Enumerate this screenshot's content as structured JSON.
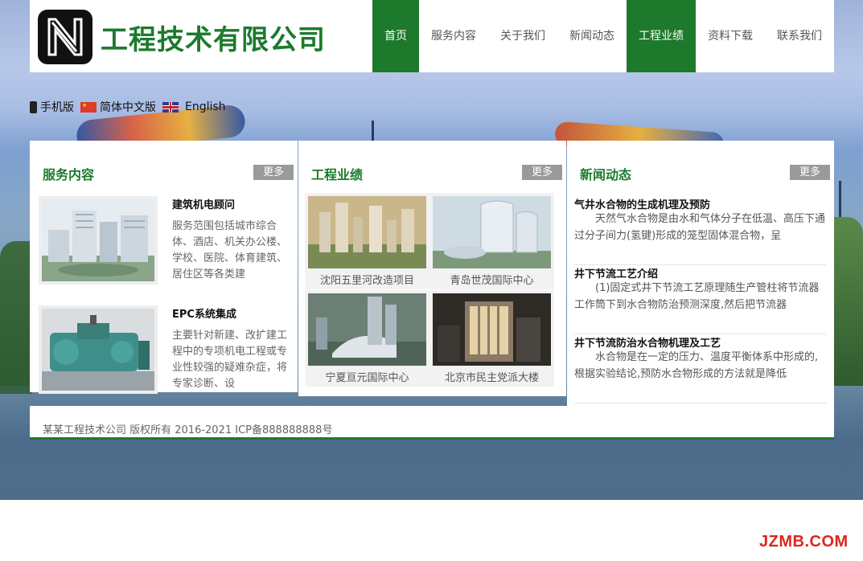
{
  "header": {
    "site_title": "工程技术有限公司",
    "logo_icon": "nfc-n-logo-icon"
  },
  "nav": {
    "items": [
      {
        "label": "首页",
        "active": true
      },
      {
        "label": "服务内容",
        "active": false
      },
      {
        "label": "关于我们",
        "active": false
      },
      {
        "label": "新闻动态",
        "active": false
      },
      {
        "label": "工程业绩",
        "active": true
      },
      {
        "label": "资料下载",
        "active": false
      },
      {
        "label": "联系我们",
        "active": false
      }
    ]
  },
  "langbar": {
    "mobile": "手机版",
    "zh": "简体中文版",
    "en": "English"
  },
  "services": {
    "title": "服务内容",
    "more": "更多",
    "items": [
      {
        "title": "建筑机电顾问",
        "desc": "服务范围包括城市综合体、酒店、机关办公楼、学校、医院、体育建筑、居住区等各类建"
      },
      {
        "title": "EPC系统集成",
        "desc": "主要针对新建、改扩建工程中的专项机电工程或专业性较强的疑难杂症，将专家诊断、设"
      }
    ]
  },
  "projects": {
    "title": "工程业绩",
    "more": "更多",
    "items": [
      {
        "caption": "沈阳五里河改造项目"
      },
      {
        "caption": "青岛世茂国际中心"
      },
      {
        "caption": "宁夏亘元国际中心"
      },
      {
        "caption": "北京市民主党派大楼"
      }
    ]
  },
  "news": {
    "title": "新闻动态",
    "more": "更多",
    "items": [
      {
        "title": "气井水合物的生成机理及预防",
        "body": "天然气水合物是由水和气体分子在低温、高压下通过分子间力(氢键)形成的笼型固体混合物，呈"
      },
      {
        "title": "井下节流工艺介绍",
        "body": "(1)固定式井下节流工艺原理随生产管柱将节流器工作筒下到水合物防治预测深度,然后把节流器"
      },
      {
        "title": "井下节流防治水合物机理及工艺",
        "body": "水合物是在一定的压力、温度平衡体系中形成的,根据实验结论,预防水合物形成的方法就是降低"
      }
    ]
  },
  "footer": {
    "text": "某某工程技术公司  版权所有 2016-2021 ICP备888888888号"
  },
  "watermark": "JZMB.COM",
  "colors": {
    "brand_green": "#1d7a2c",
    "more_button": "#9a9a9a",
    "watermark_red": "#e0251b"
  }
}
